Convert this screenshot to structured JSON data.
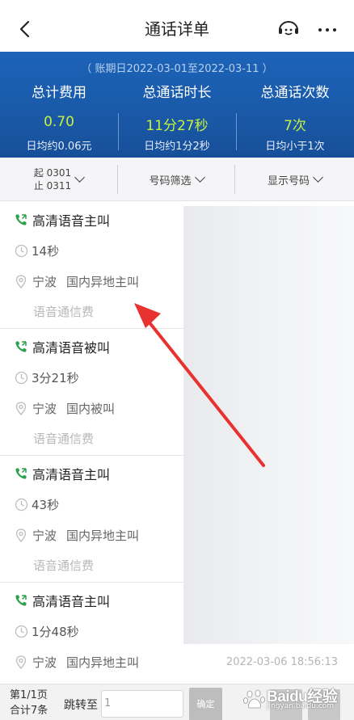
{
  "nav": {
    "title": "通话详单"
  },
  "summary": {
    "period": "（ 账期日2022-03-01至2022-03-11 ）",
    "columns": [
      {
        "label": "总计费用",
        "value": "0.70",
        "sub": "日均约0.06元"
      },
      {
        "label": "总通话时长",
        "value": "11分27秒",
        "sub": "日均约1分2秒"
      },
      {
        "label": "总通话次数",
        "value": "7次",
        "sub": "日均小于1次"
      }
    ]
  },
  "filter": {
    "start": "起 0301",
    "end": "止 0311",
    "number_filter": "号码筛选",
    "show_number": "显示号码"
  },
  "records": [
    {
      "type": "高清语音主叫",
      "duration": "14秒",
      "location": "宁波",
      "call_kind": "国内异地主叫",
      "fee_type": "语音通信费"
    },
    {
      "type": "高清语音被叫",
      "duration": "3分21秒",
      "location": "宁波",
      "call_kind": "国内被叫",
      "fee_type": "语音通信费"
    },
    {
      "type": "高清语音主叫",
      "duration": "43秒",
      "location": "宁波",
      "call_kind": "国内异地主叫",
      "fee_type": "语音通信费"
    },
    {
      "type": "高清语音主叫",
      "duration": "1分48秒",
      "location": "宁波",
      "call_kind": "国内异地主叫",
      "fee_type": ""
    }
  ],
  "timestamp": "2022-03-06 18:56:13",
  "pager": {
    "page": "第1/1页",
    "total": "合计7条",
    "jump_label": "跳转至",
    "jump_value": "1",
    "confirm": "确定"
  },
  "watermark": {
    "text": "Baidu经验",
    "sub": "jingyan.baidu.com"
  },
  "colors": {
    "header_blue": "#1a5aa9",
    "value_green": "#c9f040",
    "phone_icon": "#2aa24a",
    "arrow_red": "#e8322f"
  }
}
